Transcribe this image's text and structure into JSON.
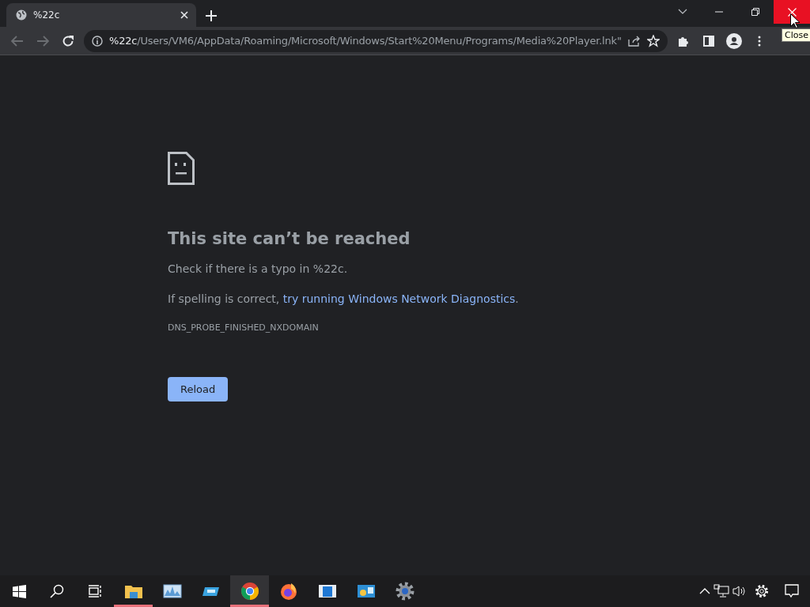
{
  "tabs": [
    {
      "title": "%22c",
      "selected": true
    }
  ],
  "address_bar": {
    "host": "%22c",
    "path": "/Users/VM6/AppData/Roaming/Microsoft/Windows/Start%20Menu/Programs/Media%20Player.lnk\""
  },
  "tooltip": "Close",
  "error_page": {
    "title": "This site can’t be reached",
    "line_1": "Check if there is a typo in %22c.",
    "line_2_prefix": "If spelling is correct, ",
    "line_2_link": "try running Windows Network Diagnostics",
    "line_2_suffix": ".",
    "error_code": "DNS_PROBE_FINISHED_NXDOMAIN",
    "button": "Reload"
  },
  "taskbar": {
    "apps": [
      {
        "kind": "explorer",
        "running": true,
        "selected": false
      },
      {
        "kind": "monitor",
        "running": false,
        "selected": false
      },
      {
        "kind": "disk",
        "running": false,
        "selected": false
      },
      {
        "kind": "chrome",
        "running": true,
        "selected": true
      },
      {
        "kind": "firefox",
        "running": false,
        "selected": false
      },
      {
        "kind": "window",
        "running": false,
        "selected": false
      },
      {
        "kind": "control",
        "running": false,
        "selected": false
      },
      {
        "kind": "gear",
        "running": false,
        "selected": false
      }
    ]
  }
}
